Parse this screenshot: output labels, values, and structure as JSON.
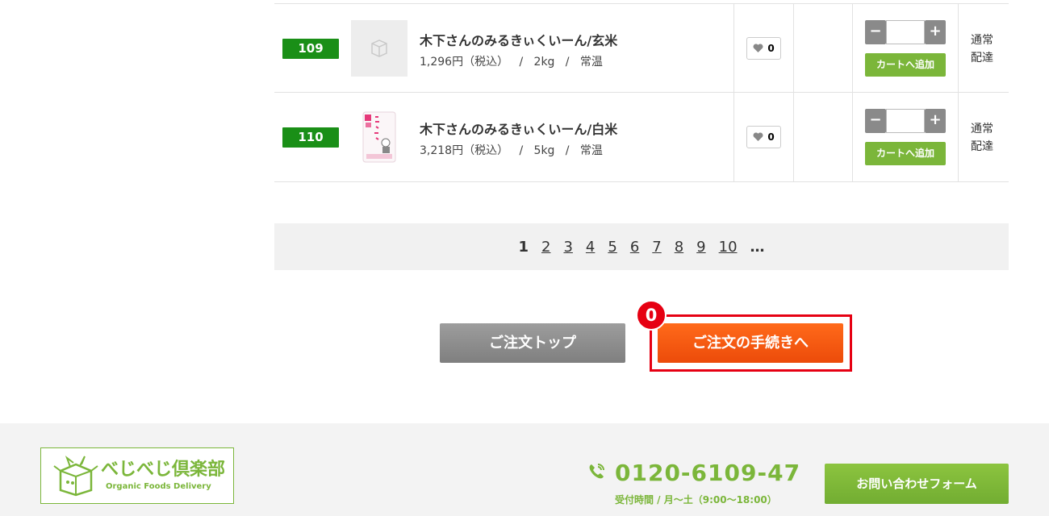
{
  "products": [
    {
      "number": "109",
      "name": "木下さんのみるきぃくいーん/玄米",
      "price": "1,296円（税込）",
      "size": "2kg",
      "storage": "常温",
      "favorite_count": "0",
      "qty_minus": "−",
      "qty_plus": "+",
      "qty_value": "",
      "cart_label": "カートへ追加",
      "delivery_line1": "通常",
      "delivery_line2": "配達",
      "image": "placeholder-box-icon"
    },
    {
      "number": "110",
      "name": "木下さんのみるきぃくいーん/白米",
      "price": "3,218円（税込）",
      "size": "5kg",
      "storage": "常温",
      "favorite_count": "0",
      "qty_minus": "−",
      "qty_plus": "+",
      "qty_value": "",
      "cart_label": "カートへ追加",
      "delivery_line1": "通常",
      "delivery_line2": "配達",
      "image": "rice-bag-photo"
    }
  ],
  "meta_separator": "/",
  "pagination": {
    "pages": [
      "1",
      "2",
      "3",
      "4",
      "5",
      "6",
      "7",
      "8",
      "9",
      "10"
    ],
    "current": "1",
    "ellipsis": "…"
  },
  "actions": {
    "order_top_label": "ご注文トップ",
    "checkout_label": "ご注文の手続きへ",
    "cart_count": "0"
  },
  "footer": {
    "logo_jp": "べじべじ倶楽部",
    "logo_en": "Organic Foods Delivery",
    "phone": "0120-6109-47",
    "hours": "受付時間 / 月〜土（9:00〜18:00）",
    "contact_label": "お問い合わせフォーム"
  },
  "colors": {
    "badge_green": "#1a8f17",
    "brand_green": "#7bb63a",
    "checkout_orange": "#f05a14",
    "highlight_red": "#e60012"
  }
}
